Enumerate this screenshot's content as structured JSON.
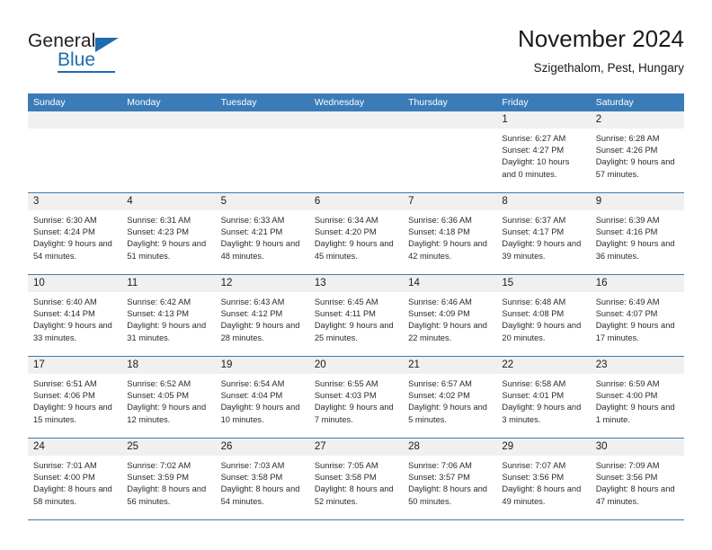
{
  "brand": {
    "name_dark": "General",
    "name_blue": "Blue",
    "accent_color": "#1f6cb0"
  },
  "header": {
    "title": "November 2024",
    "subtitle": "Szigethalom, Pest, Hungary"
  },
  "calendar": {
    "header_bg": "#3b7cb8",
    "day_band_bg": "#f0f0f0",
    "weekdays": [
      "Sunday",
      "Monday",
      "Tuesday",
      "Wednesday",
      "Thursday",
      "Friday",
      "Saturday"
    ],
    "weeks": [
      [
        {
          "day": "",
          "empty": true
        },
        {
          "day": "",
          "empty": true
        },
        {
          "day": "",
          "empty": true
        },
        {
          "day": "",
          "empty": true
        },
        {
          "day": "",
          "empty": true
        },
        {
          "day": "1",
          "sunrise": "Sunrise: 6:27 AM",
          "sunset": "Sunset: 4:27 PM",
          "daylight": "Daylight: 10 hours and 0 minutes."
        },
        {
          "day": "2",
          "sunrise": "Sunrise: 6:28 AM",
          "sunset": "Sunset: 4:26 PM",
          "daylight": "Daylight: 9 hours and 57 minutes."
        }
      ],
      [
        {
          "day": "3",
          "sunrise": "Sunrise: 6:30 AM",
          "sunset": "Sunset: 4:24 PM",
          "daylight": "Daylight: 9 hours and 54 minutes."
        },
        {
          "day": "4",
          "sunrise": "Sunrise: 6:31 AM",
          "sunset": "Sunset: 4:23 PM",
          "daylight": "Daylight: 9 hours and 51 minutes."
        },
        {
          "day": "5",
          "sunrise": "Sunrise: 6:33 AM",
          "sunset": "Sunset: 4:21 PM",
          "daylight": "Daylight: 9 hours and 48 minutes."
        },
        {
          "day": "6",
          "sunrise": "Sunrise: 6:34 AM",
          "sunset": "Sunset: 4:20 PM",
          "daylight": "Daylight: 9 hours and 45 minutes."
        },
        {
          "day": "7",
          "sunrise": "Sunrise: 6:36 AM",
          "sunset": "Sunset: 4:18 PM",
          "daylight": "Daylight: 9 hours and 42 minutes."
        },
        {
          "day": "8",
          "sunrise": "Sunrise: 6:37 AM",
          "sunset": "Sunset: 4:17 PM",
          "daylight": "Daylight: 9 hours and 39 minutes."
        },
        {
          "day": "9",
          "sunrise": "Sunrise: 6:39 AM",
          "sunset": "Sunset: 4:16 PM",
          "daylight": "Daylight: 9 hours and 36 minutes."
        }
      ],
      [
        {
          "day": "10",
          "sunrise": "Sunrise: 6:40 AM",
          "sunset": "Sunset: 4:14 PM",
          "daylight": "Daylight: 9 hours and 33 minutes."
        },
        {
          "day": "11",
          "sunrise": "Sunrise: 6:42 AM",
          "sunset": "Sunset: 4:13 PM",
          "daylight": "Daylight: 9 hours and 31 minutes."
        },
        {
          "day": "12",
          "sunrise": "Sunrise: 6:43 AM",
          "sunset": "Sunset: 4:12 PM",
          "daylight": "Daylight: 9 hours and 28 minutes."
        },
        {
          "day": "13",
          "sunrise": "Sunrise: 6:45 AM",
          "sunset": "Sunset: 4:11 PM",
          "daylight": "Daylight: 9 hours and 25 minutes."
        },
        {
          "day": "14",
          "sunrise": "Sunrise: 6:46 AM",
          "sunset": "Sunset: 4:09 PM",
          "daylight": "Daylight: 9 hours and 22 minutes."
        },
        {
          "day": "15",
          "sunrise": "Sunrise: 6:48 AM",
          "sunset": "Sunset: 4:08 PM",
          "daylight": "Daylight: 9 hours and 20 minutes."
        },
        {
          "day": "16",
          "sunrise": "Sunrise: 6:49 AM",
          "sunset": "Sunset: 4:07 PM",
          "daylight": "Daylight: 9 hours and 17 minutes."
        }
      ],
      [
        {
          "day": "17",
          "sunrise": "Sunrise: 6:51 AM",
          "sunset": "Sunset: 4:06 PM",
          "daylight": "Daylight: 9 hours and 15 minutes."
        },
        {
          "day": "18",
          "sunrise": "Sunrise: 6:52 AM",
          "sunset": "Sunset: 4:05 PM",
          "daylight": "Daylight: 9 hours and 12 minutes."
        },
        {
          "day": "19",
          "sunrise": "Sunrise: 6:54 AM",
          "sunset": "Sunset: 4:04 PM",
          "daylight": "Daylight: 9 hours and 10 minutes."
        },
        {
          "day": "20",
          "sunrise": "Sunrise: 6:55 AM",
          "sunset": "Sunset: 4:03 PM",
          "daylight": "Daylight: 9 hours and 7 minutes."
        },
        {
          "day": "21",
          "sunrise": "Sunrise: 6:57 AM",
          "sunset": "Sunset: 4:02 PM",
          "daylight": "Daylight: 9 hours and 5 minutes."
        },
        {
          "day": "22",
          "sunrise": "Sunrise: 6:58 AM",
          "sunset": "Sunset: 4:01 PM",
          "daylight": "Daylight: 9 hours and 3 minutes."
        },
        {
          "day": "23",
          "sunrise": "Sunrise: 6:59 AM",
          "sunset": "Sunset: 4:00 PM",
          "daylight": "Daylight: 9 hours and 1 minute."
        }
      ],
      [
        {
          "day": "24",
          "sunrise": "Sunrise: 7:01 AM",
          "sunset": "Sunset: 4:00 PM",
          "daylight": "Daylight: 8 hours and 58 minutes."
        },
        {
          "day": "25",
          "sunrise": "Sunrise: 7:02 AM",
          "sunset": "Sunset: 3:59 PM",
          "daylight": "Daylight: 8 hours and 56 minutes."
        },
        {
          "day": "26",
          "sunrise": "Sunrise: 7:03 AM",
          "sunset": "Sunset: 3:58 PM",
          "daylight": "Daylight: 8 hours and 54 minutes."
        },
        {
          "day": "27",
          "sunrise": "Sunrise: 7:05 AM",
          "sunset": "Sunset: 3:58 PM",
          "daylight": "Daylight: 8 hours and 52 minutes."
        },
        {
          "day": "28",
          "sunrise": "Sunrise: 7:06 AM",
          "sunset": "Sunset: 3:57 PM",
          "daylight": "Daylight: 8 hours and 50 minutes."
        },
        {
          "day": "29",
          "sunrise": "Sunrise: 7:07 AM",
          "sunset": "Sunset: 3:56 PM",
          "daylight": "Daylight: 8 hours and 49 minutes."
        },
        {
          "day": "30",
          "sunrise": "Sunrise: 7:09 AM",
          "sunset": "Sunset: 3:56 PM",
          "daylight": "Daylight: 8 hours and 47 minutes."
        }
      ]
    ]
  }
}
